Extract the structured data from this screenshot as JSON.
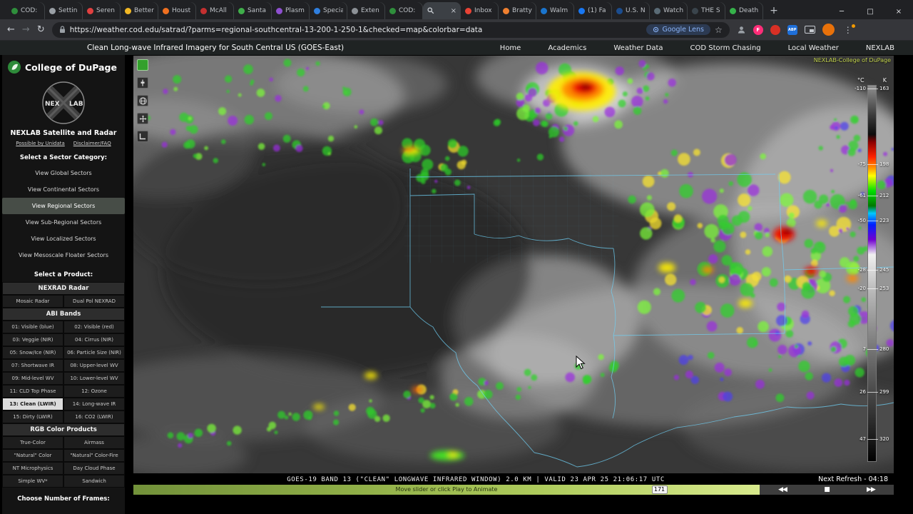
{
  "browser": {
    "tabs": [
      {
        "label": "COD:",
        "color": "#2f8f3c"
      },
      {
        "label": "Settin",
        "color": "#9aa0a6"
      },
      {
        "label": "Seren",
        "color": "#e04040"
      },
      {
        "label": "Better",
        "color": "#f2b824"
      },
      {
        "label": "Houst",
        "color": "#f07020"
      },
      {
        "label": "McAll",
        "color": "#c43030"
      },
      {
        "label": "Santa",
        "color": "#3fae4a"
      },
      {
        "label": "Plasm",
        "color": "#8e4fd0"
      },
      {
        "label": "Specia",
        "color": "#2f7fe0"
      },
      {
        "label": "Exten",
        "color": "#8c9196"
      },
      {
        "label": "COD:",
        "color": "#2f8f3c"
      },
      {
        "label": "",
        "icon": "search"
      },
      {
        "label": "Inbox",
        "color": "#ea4335"
      },
      {
        "label": "Bratty",
        "color": "#f08030"
      },
      {
        "label": "Walm",
        "color": "#1a75ce"
      },
      {
        "label": "(1) Fa",
        "color": "#1877f2"
      },
      {
        "label": "U.S. N",
        "color": "#1b4d8f"
      },
      {
        "label": "Watch",
        "color": "#5a6b76"
      },
      {
        "label": "THE S",
        "color": "#3a444c"
      },
      {
        "label": "Death",
        "color": "#35b24a"
      }
    ],
    "active_index": 11,
    "new_tab_glyph": "+",
    "window_controls": [
      {
        "name": "minimize",
        "glyph": "─"
      },
      {
        "name": "maximize",
        "glyph": "□"
      },
      {
        "name": "close",
        "glyph": "×"
      }
    ],
    "toolbar": {
      "back_glyph": "←",
      "forward_glyph": "→",
      "refresh_glyph": "↻",
      "url": "https://weather.cod.edu/satrad/?parms=regional-southcentral-13-200-1-250-1&checked=map&colorbar=data",
      "lens_label": "Google Lens",
      "star_glyph": "☆",
      "menu_glyph": "⋮"
    }
  },
  "site": {
    "title": "Clean Long-wave Infrared Imagery for South Central US (GOES-East)",
    "nav": [
      "Home",
      "Academics",
      "Weather Data",
      "COD Storm Chasing",
      "Local Weather",
      "NEXLAB"
    ]
  },
  "sidebar": {
    "brand": "College of DuPage",
    "logo_text_left": "NEX",
    "logo_text_right": "LAB",
    "app_title": "NEXLAB Satellite and Radar",
    "links": [
      "Possible by Unidata",
      "Disclaimer/FAQ"
    ],
    "sector_heading": "Select a Sector Category:",
    "sectors": [
      "View Global Sectors",
      "View Continental Sectors",
      "View Regional Sectors",
      "View Sub-Regional Sectors",
      "View Localized Sectors",
      "View Mesoscale Floater Sectors"
    ],
    "active_sector_index": 2,
    "product_heading": "Select a Product:",
    "nexrad_heading": "NEXRAD Radar",
    "nexrad_items": [
      "Mosaic Radar",
      "Dual Pol NEXRAD"
    ],
    "abi_heading": "ABI Bands",
    "abi_items": [
      "01: Visible (blue)",
      "02: Visible (red)",
      "03: Veggie (NIR)",
      "04: Cirrus (NIR)",
      "05: Snow/Ice (NIR)",
      "06: Particle Size (NIR)",
      "07: Shortwave IR",
      "08: Upper-level WV",
      "09: Mid-level WV",
      "10: Lower-level WV",
      "11: CLD Top Phase",
      "12: Ozone",
      "13: Clean (LWIR)",
      "14: Long-wave IR",
      "15: Dirty (LWIR)",
      "16: CO2 (LWIR)"
    ],
    "active_abi_index": 12,
    "rgb_heading": "RGB Color Products",
    "rgb_items": [
      "True-Color",
      "Airmass",
      "\"Natural\" Color",
      "\"Natural\" Color-Fire",
      "NT Microphysics",
      "Day Cloud Phase",
      "Simple WV*",
      "Sandwich"
    ],
    "frames_heading": "Choose Number of Frames:"
  },
  "map": {
    "attribution": "NEXLAB-College of DuPage",
    "caption": "GOES-19 BAND 13 (\"CLEAN\" LONGWAVE INFRARED WINDOW) 2.0 KM | VALID 23 APR 25 21:06:17 UTC",
    "next_refresh": "Next Refresh - 04:18",
    "slider": {
      "hint": "Move slider or click Play to Animate",
      "frame": "171",
      "position_pct": 84
    },
    "controls": [
      {
        "name": "step-back",
        "glyph": "◀◀"
      },
      {
        "name": "stop",
        "glyph": "■"
      },
      {
        "name": "step-forward",
        "glyph": "▶▶"
      }
    ],
    "colorbar": {
      "unit_left": "°C",
      "unit_right": "K",
      "ticks": [
        {
          "c": "-110",
          "k": "163"
        },
        {
          "c": "-75",
          "k": "198"
        },
        {
          "c": "-61",
          "k": "212"
        },
        {
          "c": "-50",
          "k": "223"
        },
        {
          "c": "-28",
          "k": "245"
        },
        {
          "c": "-20",
          "k": "253"
        },
        {
          "c": "7",
          "k": "280"
        },
        {
          "c": "26",
          "k": "299"
        },
        {
          "c": "47",
          "k": "320"
        }
      ]
    }
  }
}
